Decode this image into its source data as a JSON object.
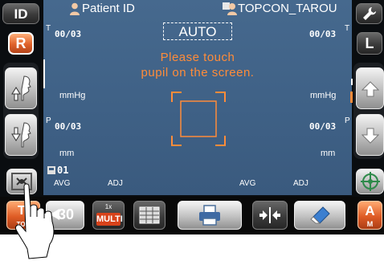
{
  "left_panel": {
    "id_button": "ID",
    "r_button": "R",
    "rotate_icon": "rotate-icon",
    "up_button_icon": "face-up-icon",
    "down_button_icon": "face-down-icon",
    "target_icon": "crosshair-icon"
  },
  "header": {
    "patient_id_label": "Patient ID",
    "operator_name": "TOPCON_TAROU",
    "mode_label": "AUTO"
  },
  "right_panel": {
    "wrench_icon": "wrench-icon",
    "l_button": "L",
    "up_icon": "arrow-up-icon",
    "down_icon": "arrow-down-icon",
    "target_icon": "target-icon"
  },
  "measurement": {
    "right_eye": {
      "t_marker": "T",
      "t_count": "00/03",
      "p_marker": "P",
      "p_count": "00/03",
      "unit_top": "mmHg",
      "unit_bottom": "mm",
      "avg_label": "AVG",
      "adj_label": "ADJ"
    },
    "left_eye": {
      "t_marker": "T",
      "t_count": "00/03",
      "p_marker": "P",
      "p_count": "00/03",
      "unit_top": "mmHg",
      "unit_bottom": "mm",
      "avg_label": "AVG",
      "adj_label": "ADJ"
    },
    "sequence_number": "01"
  },
  "instruction": {
    "line1": "Please touch",
    "line2": "pupil on the screen."
  },
  "toolbar": {
    "ton_top": "T/",
    "ton_bottom": "TON",
    "counter_value": "30",
    "multi_top": "1x",
    "multi_label": "MULTI",
    "table_icon": "table-icon",
    "print_icon": "printer-icon",
    "split_icon": "split-arrows-icon",
    "eraser_icon": "eraser-icon",
    "a_label": "A",
    "m_label": "M"
  },
  "colors": {
    "accent": "#ff8c3a",
    "screen_bg": "#42658a"
  }
}
